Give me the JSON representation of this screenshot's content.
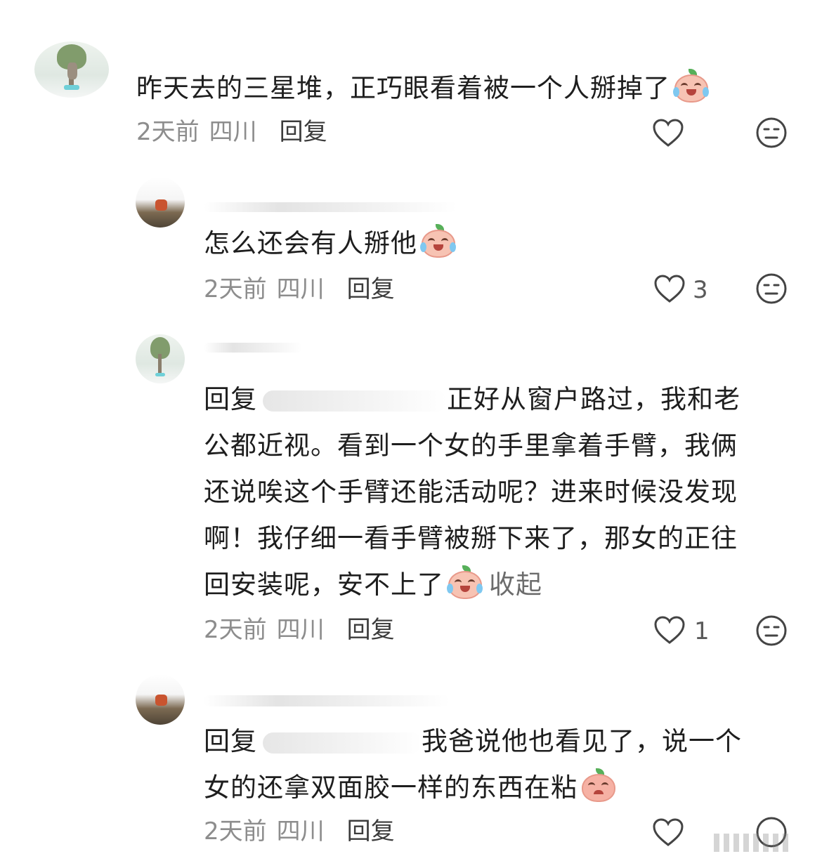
{
  "comments": [
    {
      "text": "昨天去的三星堆，正巧眼看着被一个人掰掉了",
      "time": "2天前",
      "location": "四川",
      "reply_label": "回复",
      "likes": ""
    },
    {
      "text": "怎么还会有人掰他",
      "time": "2天前",
      "location": "四川",
      "reply_label": "回复",
      "likes": "3"
    },
    {
      "reply_prefix": "回复",
      "line1": "正好从窗户路过，我和老",
      "line2": "公都近视。看到一个女的手里拿着手臂，我俩",
      "line3": "还说唉这个手臂还能活动呢？进来时候没发现",
      "line4": "啊！我仔细一看手臂被掰下来了，那女的正往",
      "line5": "回安装呢，安不上了",
      "collapse": "收起",
      "time": "2天前",
      "location": "四川",
      "reply_label": "回复",
      "likes": "1"
    },
    {
      "reply_prefix": "回复",
      "line1": "我爸说他也看见了，说一个",
      "line2": "女的还拿双面胶一样的东西在粘",
      "time": "2天前",
      "location": "四川",
      "reply_label": "回复",
      "likes": ""
    }
  ],
  "icons": {
    "like": "heart-icon",
    "dislike": "neutral-face-icon",
    "emoji_cry": "crying-peach-emoji",
    "emoji_sad": "sad-peach-emoji"
  }
}
